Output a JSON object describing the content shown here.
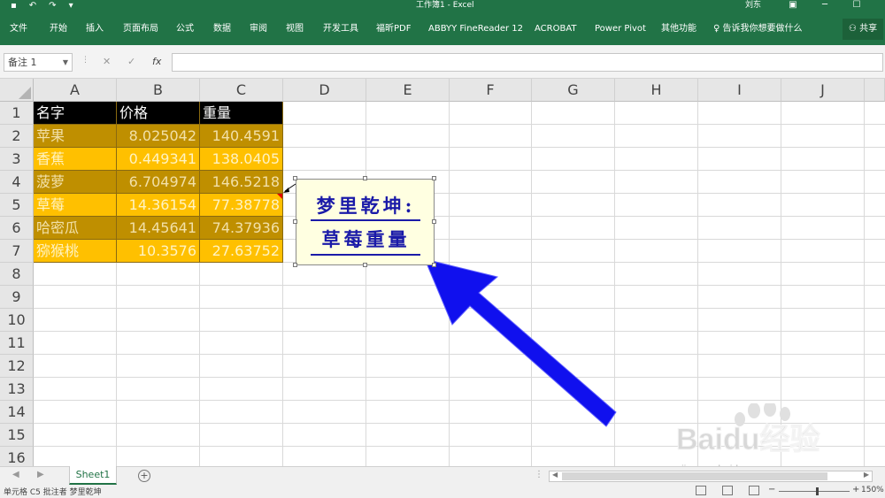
{
  "titlebar": {
    "title": "工作簿1 - Excel",
    "user": "刘东",
    "qa_icons": [
      "save-icon",
      "undo-icon",
      "redo-icon",
      "customize-icon"
    ]
  },
  "ribbon": {
    "tabs": [
      "文件",
      "开始",
      "插入",
      "页面布局",
      "公式",
      "数据",
      "审阅",
      "视图",
      "开发工具",
      "福昕PDF",
      "ABBYY FineReader 12",
      "ACROBAT",
      "Power Pivot",
      "其他功能"
    ],
    "tellme": "告诉我你想要做什么",
    "share": "共享"
  },
  "formula_bar": {
    "name_box": "备注 1",
    "fx": "fx",
    "value": ""
  },
  "columns": [
    "A",
    "B",
    "C",
    "D",
    "E",
    "F",
    "G",
    "H",
    "I",
    "J"
  ],
  "rows": [
    "1",
    "2",
    "3",
    "4",
    "5",
    "6",
    "7",
    "8",
    "9",
    "10",
    "11",
    "12",
    "13",
    "14",
    "15",
    "16"
  ],
  "table": {
    "headers": [
      "名字",
      "价格",
      "重量"
    ],
    "rows": [
      [
        "苹果",
        "8.025042",
        "140.4591"
      ],
      [
        "香蕉",
        "0.449341",
        "138.0405"
      ],
      [
        "菠萝",
        "6.704974",
        "146.5218"
      ],
      [
        "草莓",
        "14.36154",
        "77.38778"
      ],
      [
        "哈密瓜",
        "14.45641",
        "74.37936"
      ],
      [
        "猕猴桃",
        "10.3576",
        "27.63752"
      ]
    ]
  },
  "comment": {
    "line1": "梦里乾坤:",
    "line2": "草莓重量"
  },
  "sheet_tabs": {
    "active": "Sheet1",
    "add": "+"
  },
  "status": {
    "text": "单元格 C5 批注者 梦里乾坤",
    "zoom": "150%"
  },
  "watermark": {
    "brand": "Baidu经验",
    "url": "jingyan.baidu.com"
  },
  "colors": {
    "excel_green": "#217346",
    "header_fill": "#000000",
    "row_dark": "#bf8f00",
    "row_light": "#ffc000",
    "comment_text": "#1a1aa8",
    "arrow": "#1010ee"
  }
}
